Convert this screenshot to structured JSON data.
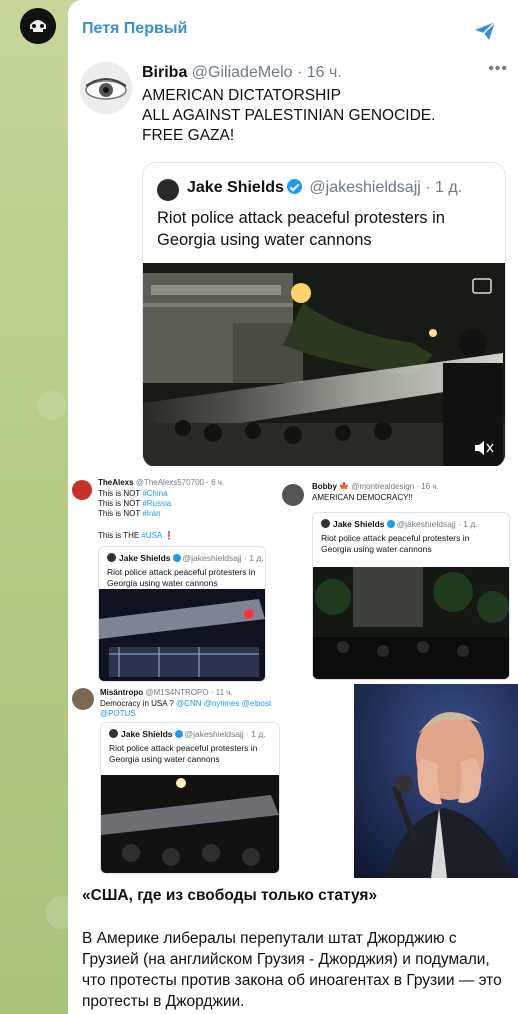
{
  "channel": {
    "name": "Петя Первый"
  },
  "tweet": {
    "author": "Biriba",
    "handle": "@GiliadeMelo",
    "time": "· 16 ч.",
    "more": "•••",
    "text": "AMERICAN DICTATORSHIP\nALL AGAINST PALESTINIAN GENOCIDE.\nFREE GAZA!"
  },
  "quote": {
    "author": "Jake Shields",
    "handle": "@jakeshieldsajj",
    "time": "· 1 д.",
    "text": "Riot police attack peaceful protesters in Georgia using water cannons"
  },
  "collage": {
    "a": {
      "author": "TheAlexs",
      "handle": "@TheAlexs570700",
      "time": "· 6 ч.",
      "lines": [
        "This is NOT",
        "This is NOT",
        "This is NOT"
      ],
      "tags": [
        "#China",
        "#Russia",
        "#Iran"
      ],
      "last": "This is THE",
      "last_tag": "#USA",
      "last_mark": "❗",
      "q_author": "Jake Shields",
      "q_handle": "@jakeshieldsajj",
      "q_time": "· 1 д.",
      "q_text": "Riot police attack peaceful protesters in Georgia using water cannons"
    },
    "b": {
      "author": "Bobby",
      "flag": "🍁",
      "handle": "@montrealdesign",
      "time": "· 16 ч.",
      "text": "AMERICAN DEMOCRACY!!",
      "q_author": "Jake Shields",
      "q_handle": "@jakeshieldsajj",
      "q_time": "· 1 д.",
      "q_text": "Riot police attack peaceful protesters in Georgia using water cannons"
    },
    "c": {
      "author": "Misántropo",
      "handle": "@M1S4NTROPO",
      "time": "· 11 ч.",
      "text": "Democracy in USA ?",
      "mentions1": "@CNN @nytimes @elpost",
      "mentions2": "@POTUS",
      "q_author": "Jake Shields",
      "q_handle": "@jakeshieldsajj",
      "q_time": "· 1 д.",
      "q_text": "Riot police attack peaceful protesters in Georgia using water cannons"
    }
  },
  "message": {
    "title": "«США, где из свободы только статуя»",
    "body": "В Америке либералы перепутали штат Джорджию с Грузией (на английском Грузия - Джорджия) и подумали, что протесты против закона об иноагентах в Грузии — это протесты в Джорджии."
  },
  "colors": {
    "link": "#3a8fd6",
    "verified": "#1d9bf0",
    "accent_red": "#e0245e"
  },
  "icons": [
    "share-icon",
    "verified-icon",
    "gif-icon",
    "mute-icon"
  ]
}
